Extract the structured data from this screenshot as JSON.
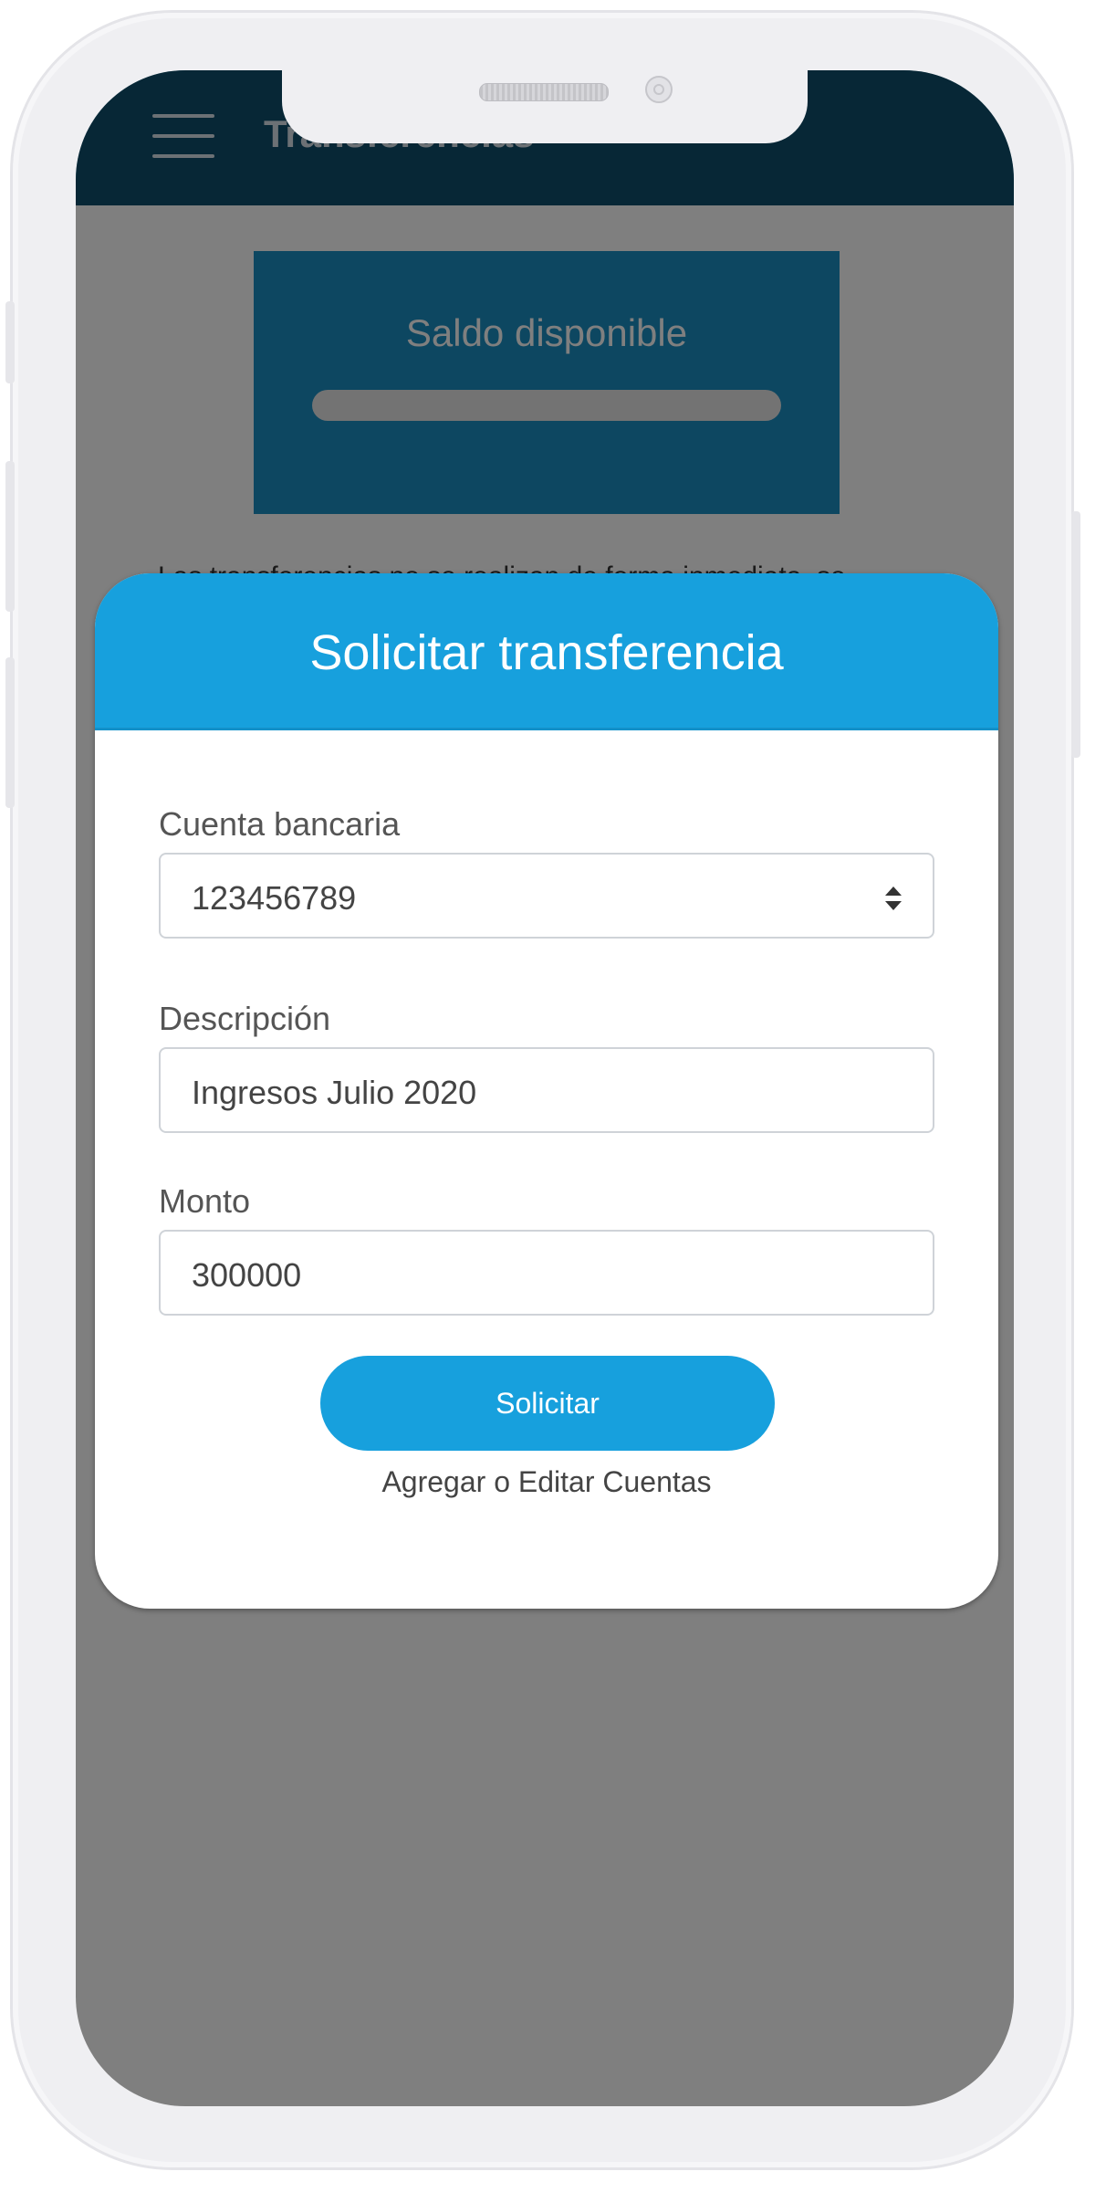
{
  "app": {
    "title": "Transferencias",
    "balance_label": "Saldo disponible",
    "info_text": "Las transferencias no se realizan de forma inmediata, se"
  },
  "modal": {
    "title": "Solicitar transferencia",
    "fields": {
      "cuenta": {
        "label": "Cuenta bancaria",
        "value": "123456789"
      },
      "descripcion": {
        "label": "Descripción",
        "value": "Ingresos Julio 2020"
      },
      "monto": {
        "label": "Monto",
        "value": "300000"
      }
    },
    "submit_label": "Solicitar",
    "edit_accounts_label": "Agregar o Editar Cuentas"
  },
  "icons": {
    "menu": "hamburger-menu-icon",
    "select": "select-arrows-icon"
  },
  "colors": {
    "header": "#0e4f6c",
    "accent": "#17a0dd",
    "balance_card": "#1a8fc2"
  }
}
